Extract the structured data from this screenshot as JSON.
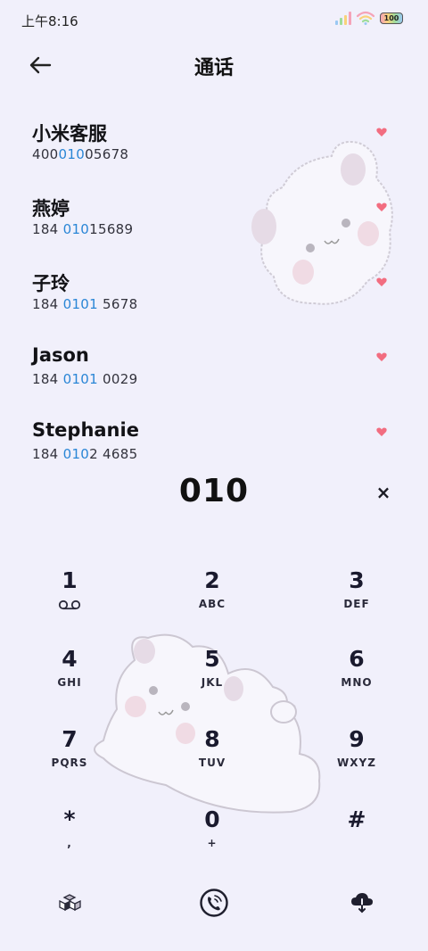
{
  "status": {
    "time": "上午8:16",
    "battery": "100"
  },
  "header": {
    "title": "通话"
  },
  "contacts": [
    {
      "name": "小米客服",
      "number_pre": "400",
      "number_hl": "010",
      "number_post": "05678"
    },
    {
      "name": "燕婷",
      "number_pre": "184 ",
      "number_hl": "010",
      "number_post": "15689"
    },
    {
      "name": "子玲",
      "number_pre": "184 ",
      "number_hl": "0101",
      "number_post": " 5678"
    },
    {
      "name": "Jason",
      "number_pre": "184 ",
      "number_hl": "0101",
      "number_post": " 0029"
    },
    {
      "name": "Stephanie",
      "number_pre": "184 ",
      "number_hl": "010",
      "number_post": "2 4685"
    }
  ],
  "dial": {
    "number": "010",
    "clear_label": "×"
  },
  "keypad": [
    {
      "digit": "1",
      "letters": ""
    },
    {
      "digit": "2",
      "letters": "ABC"
    },
    {
      "digit": "3",
      "letters": "DEF"
    },
    {
      "digit": "4",
      "letters": "GHI"
    },
    {
      "digit": "5",
      "letters": "JKL"
    },
    {
      "digit": "6",
      "letters": "MNO"
    },
    {
      "digit": "7",
      "letters": "PQRS"
    },
    {
      "digit": "8",
      "letters": "TUV"
    },
    {
      "digit": "9",
      "letters": "WXYZ"
    },
    {
      "digit": "*",
      "letters": ","
    },
    {
      "digit": "0",
      "letters": "+"
    },
    {
      "digit": "#",
      "letters": ""
    }
  ],
  "colors": {
    "background": "#f1f0fb",
    "highlight": "#2a86d6",
    "heart": "#f26d80"
  },
  "icons": {
    "back": "back-arrow-icon",
    "voicemail": "voicemail-icon",
    "clear": "close-icon",
    "bottom_left": "cubes-icon",
    "bottom_center": "phone-call-icon",
    "bottom_right": "cloud-download-icon"
  }
}
